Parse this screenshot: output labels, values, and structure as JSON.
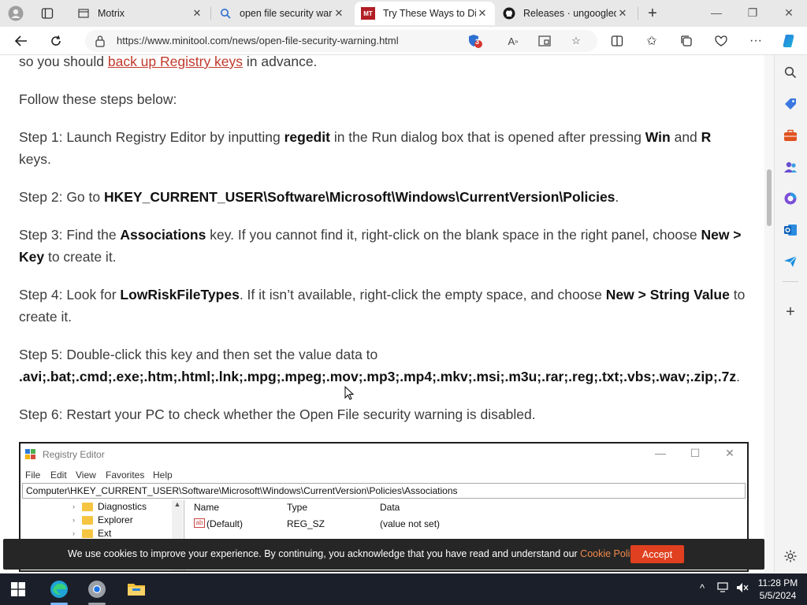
{
  "browser": {
    "tabs": [
      {
        "title": "Motrix",
        "active": false
      },
      {
        "title": "open file security war",
        "active": false
      },
      {
        "title": "Try These Ways to Dis",
        "active": true
      },
      {
        "title": "Releases · ungoogled",
        "active": false
      }
    ],
    "new_tab": "+",
    "address": "https://www.minitool.com/news/open-file-security-warning.html",
    "badge_count": "3",
    "window_controls": {
      "minimize": "—",
      "restore": "❐",
      "close": "✕"
    }
  },
  "article": {
    "p0_pre": "so you should ",
    "p0_link": "back up Registry keys",
    "p0_post": " in advance.",
    "p1": "Follow these steps below:",
    "s1_a": "Step 1: Launch Registry Editor by inputting ",
    "s1_b": "regedit",
    "s1_c": " in the Run dialog box that is opened after pressing ",
    "s1_d": "Win",
    "s1_e": " and ",
    "s1_f": "R",
    "s1_g": "keys.",
    "s2_a": "Step 2: Go to ",
    "s2_b": "HKEY_CURRENT_USER\\Software\\Microsoft\\Windows\\CurrentVersion\\Policies",
    "s2_c": ".",
    "s3_a": "Step 3: Find the ",
    "s3_b": "Associations",
    "s3_c": " key. If you cannot find it, right-click on the blank space in the right panel, choose ",
    "s3_d": "New >",
    "s3_e": "Key",
    "s3_f": " to create it.",
    "s4_a": "Step 4: Look for ",
    "s4_b": "LowRiskFileTypes",
    "s4_c": ". If it isn’t available, right-click the empty space, and choose ",
    "s4_d": "New > String Value",
    "s4_e": " to",
    "s4_f": "create it.",
    "s5_a": "Step 5: Double-click this key and then set the value data to",
    "s5_b": ".avi;.bat;.cmd;.exe;.htm;.html;.lnk;.mpg;.mpeg;.mov;.mp3;.mp4;.mkv;.msi;.m3u;.rar;.reg;.txt;.vbs;.wav;.zip;.7z",
    "s5_c": ".",
    "s6": "Step 6: Restart your PC to check whether the Open File security warning is disabled."
  },
  "regedit": {
    "title": "Registry Editor",
    "menu": [
      "File",
      "Edit",
      "View",
      "Favorites",
      "Help"
    ],
    "path": "Computer\\HKEY_CURRENT_USER\\Software\\Microsoft\\Windows\\CurrentVersion\\Policies\\Associations",
    "tree": [
      "Diagnostics",
      "Explorer",
      "Ext"
    ],
    "columns": [
      "Name",
      "Type",
      "Data"
    ],
    "rows": [
      {
        "name": "(Default)",
        "type": "REG_SZ",
        "data": "(value not set)"
      }
    ]
  },
  "cookie": {
    "text": "We use cookies to improve your experience. By continuing, you acknowledge that you have read and understand our ",
    "link": "Cookie Policy",
    "end": ".",
    "accept": "Accept"
  },
  "taskbar": {
    "time": "11:28 PM",
    "date": "5/5/2024"
  },
  "colors": {
    "link": "#c0392b",
    "accept": "#e0401f",
    "cookie_link": "#f08a4b",
    "taskbar": "#1b1f2a"
  }
}
